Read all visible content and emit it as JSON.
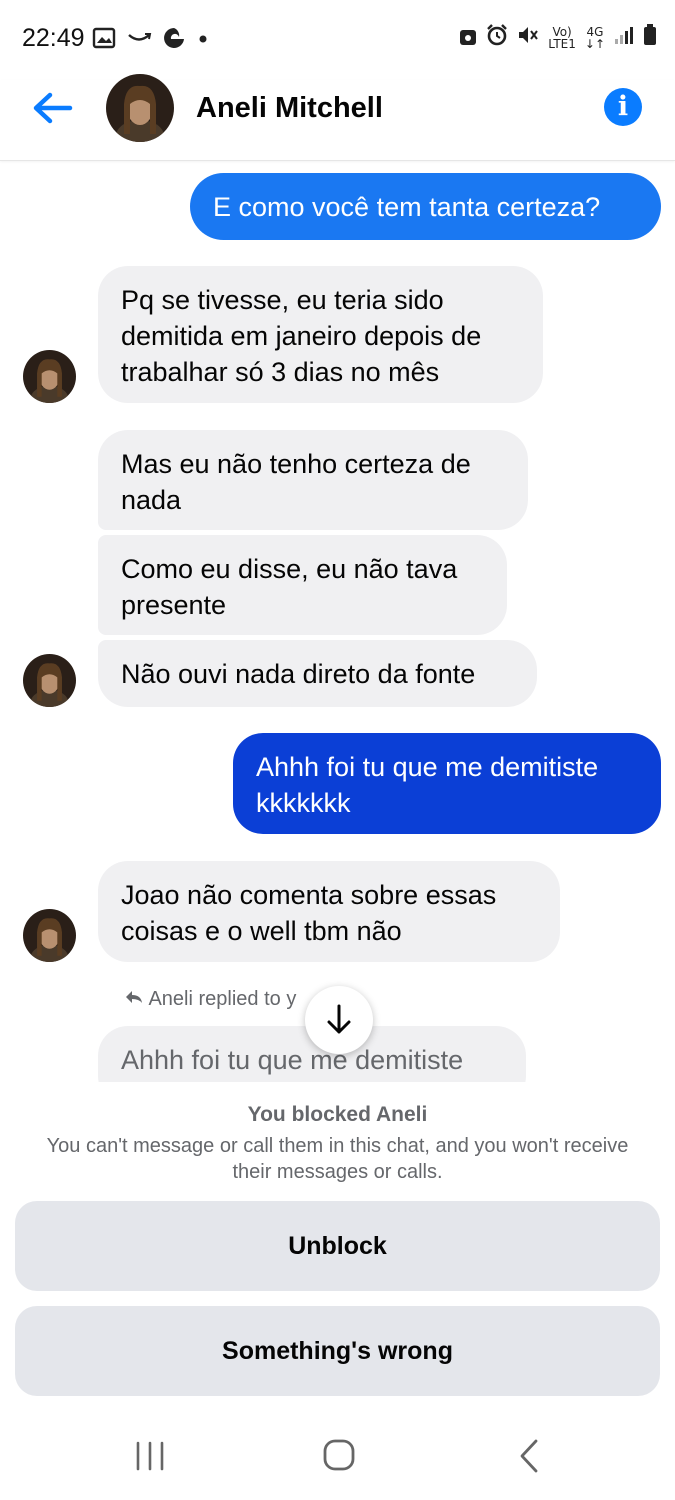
{
  "status_bar": {
    "time": "22:49",
    "left_icons": [
      "image-icon",
      "amazon-smile-icon",
      "edge-icon",
      "dot-icon"
    ],
    "right_icons": [
      "lock-icon",
      "alarm-icon",
      "mute-icon",
      "volte-icon",
      "network-4g-icon",
      "signal-icon",
      "battery-icon"
    ],
    "volte_top": "Vo)",
    "volte_bottom": "LTE1",
    "network_label": "4G"
  },
  "header": {
    "contact_name": "Aneli Mitchell",
    "back_icon": "arrow-left-icon",
    "info_icon": "info-icon",
    "info_glyph": "i",
    "accent_color": "#0a7cff"
  },
  "messages": [
    {
      "direction": "outgoing",
      "text": "E como você tem tanta certeza?"
    },
    {
      "direction": "incoming",
      "text": "Pq se tivesse, eu teria sido demitida em janeiro depois de trabalhar só 3 dias no mês"
    },
    {
      "direction": "incoming",
      "text": "Mas eu não tenho certeza de nada"
    },
    {
      "direction": "incoming",
      "text": "Como eu disse, eu não tava presente"
    },
    {
      "direction": "incoming",
      "text": "Não ouvi nada direto da fonte"
    },
    {
      "direction": "outgoing",
      "text": "Ahhh foi tu que me demitiste kkkkkkk"
    },
    {
      "direction": "incoming",
      "text": "Joao não comenta sobre essas coisas e o well tbm não"
    },
    {
      "direction": "incoming-reply-quote",
      "text": "Ahhh foi tu que me demitiste kkkkkkk"
    }
  ],
  "reply_note": "Aneli replied to y",
  "scroll_down_icon": "arrow-down-icon",
  "blocked": {
    "title": "You blocked Aneli",
    "description": "You can't message or call them in this chat, and you won't receive their messages or calls.",
    "unblock_label": "Unblock",
    "wrong_label": "Something's wrong"
  },
  "nav_bar": {
    "icons": [
      "recent-apps-icon",
      "home-icon",
      "back-nav-icon"
    ]
  },
  "colors": {
    "outgoing_bubble_top": "#1877f2",
    "outgoing_bubble_second": "#0a3fd4",
    "incoming_bubble": "#f0f0f2",
    "button_bg": "#e4e6eb"
  }
}
